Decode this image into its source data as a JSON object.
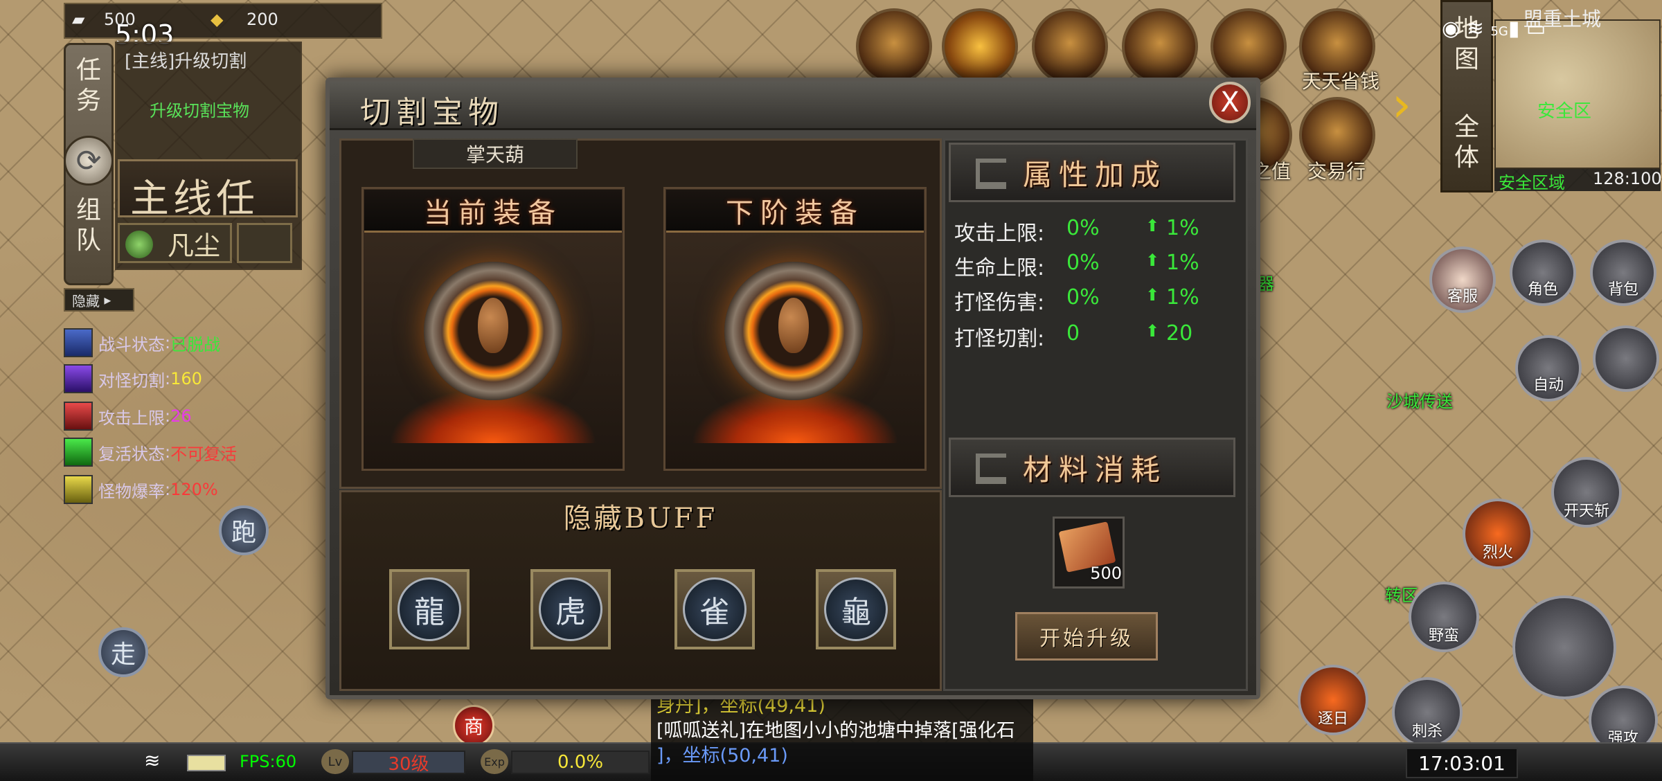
{
  "resources": {
    "ingot_count": "500",
    "gold_count": "200"
  },
  "clock": "5:03",
  "quest": {
    "title": "[主线]升级切割",
    "desc": "升级切割宝物",
    "banner": "主线任",
    "tag": "凡尘"
  },
  "side_tabs": {
    "task": "任务",
    "team": "组队"
  },
  "hide_label": "隐藏",
  "stats": [
    {
      "label": "战斗状态",
      "value": "已脱战",
      "value_color": "#3ae83a"
    },
    {
      "label": "对怪切割",
      "value": "160",
      "value_color": "#f8e838"
    },
    {
      "label": "攻击上限",
      "value": "26",
      "value_color": "#e83ae8"
    },
    {
      "label": "复活状态",
      "value": "不可复活",
      "value_color": "#f83a3a"
    },
    {
      "label": "怪物爆率",
      "value": "120%",
      "value_color": "#f83a3a"
    }
  ],
  "joystick": {
    "run": "跑",
    "walk": "走"
  },
  "top_icons": [
    {
      "name": "activity",
      "label": "天天省钱"
    },
    {
      "name": "trade",
      "label": "交易行"
    },
    {
      "name": "value",
      "label": "之值"
    }
  ],
  "map": {
    "tab_map": "地图",
    "tab_all": "全体",
    "name": "盟重土城",
    "safe_zone": "安全区",
    "area": "安全区域",
    "coords": "128:100"
  },
  "status_bar": {
    "network": "5G"
  },
  "right_labels": {
    "sand_city": "沙城传送",
    "weapon": "器",
    "transfer": "转区",
    "right_customer": "客服",
    "role": "角色",
    "bag": "背包",
    "auto": "自动"
  },
  "skills": [
    {
      "name": "kaitianzhan",
      "label": "开天斩"
    },
    {
      "name": "liehuo",
      "label": "烈火"
    },
    {
      "name": "yeman",
      "label": "野蛮"
    },
    {
      "name": "zhuri",
      "label": "逐日"
    },
    {
      "name": "cisha",
      "label": "刺杀"
    },
    {
      "name": "qianggong",
      "label": "强攻"
    }
  ],
  "bottom": {
    "fps": "FPS:60",
    "lv_badge": "Lv",
    "level": "30级",
    "exp_badge": "Exp",
    "exp": "0.0%",
    "time": "17:03:01",
    "shop": "商"
  },
  "chat": [
    {
      "text": "身丹]，坐标(49,41)"
    },
    {
      "text": "[呱呱送礼]在地图小小的池塘中掉落[强化石"
    },
    {
      "text": "]，坐标(50,41)"
    }
  ],
  "modal": {
    "title": "切割宝物",
    "item_name": "掌天葫",
    "current_equip": "当前装备",
    "next_equip": "下阶装备",
    "buff_title": "隐藏BUFF",
    "buff_icons": [
      "dragon-icon",
      "tiger-icon",
      "phoenix-icon",
      "tortoise-icon"
    ],
    "attr_header": "属性加成",
    "attributes": [
      {
        "label": "攻击上限:",
        "current": "0%",
        "next": "1%"
      },
      {
        "label": "生命上限:",
        "current": "0%",
        "next": "1%"
      },
      {
        "label": "打怪伤害:",
        "current": "0%",
        "next": "1%"
      },
      {
        "label": "打怪切割:",
        "current": "0",
        "next": "20"
      }
    ],
    "material_header": "材料消耗",
    "material_count": "500",
    "upgrade_button": "开始升级",
    "close": "X"
  }
}
